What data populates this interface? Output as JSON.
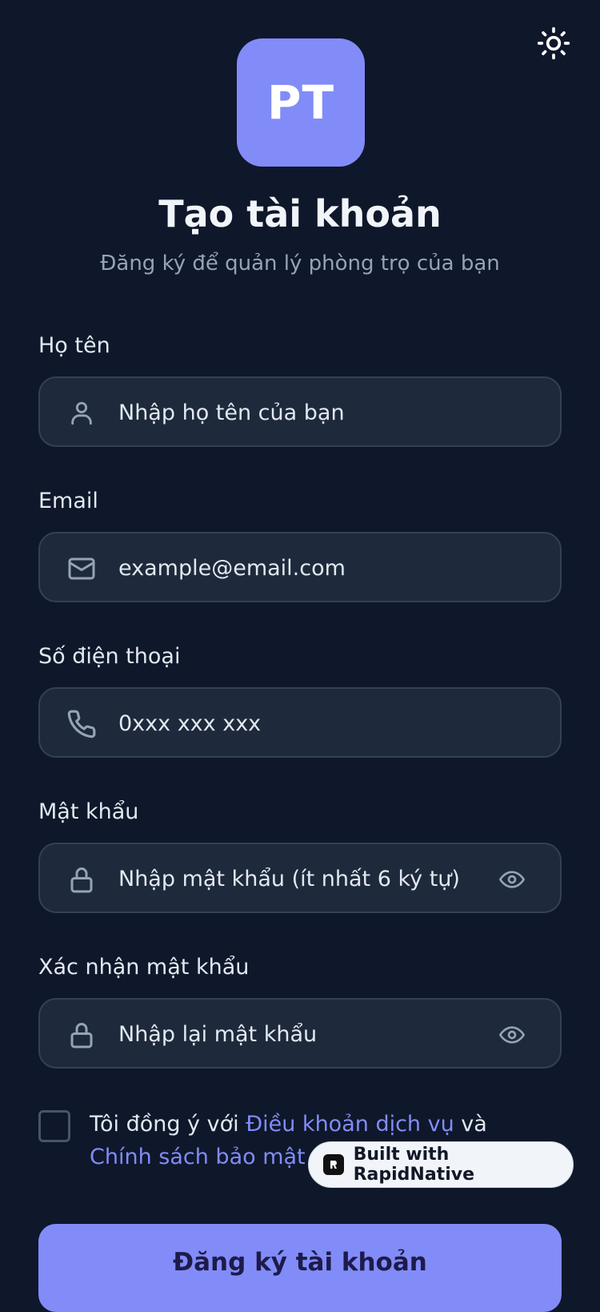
{
  "logo": {
    "text": "PT"
  },
  "header": {
    "title": "Tạo tài khoản",
    "subtitle": "Đăng ký để quản lý phòng trọ của bạn"
  },
  "form": {
    "fullname": {
      "label": "Họ tên",
      "placeholder": "Nhập họ tên của bạn",
      "icon": "user-icon"
    },
    "email": {
      "label": "Email",
      "placeholder": "example@email.com",
      "icon": "mail-icon"
    },
    "phone": {
      "label": "Số điện thoại",
      "placeholder": "0xxx xxx xxx",
      "icon": "phone-icon"
    },
    "password": {
      "label": "Mật khẩu",
      "placeholder": "Nhập mật khẩu (ít nhất 6 ký tự)",
      "icon": "lock-icon"
    },
    "confirm": {
      "label": "Xác nhận mật khẩu",
      "placeholder": "Nhập lại mật khẩu",
      "icon": "lock-icon"
    }
  },
  "terms": {
    "prefix": "Tôi đồng ý với ",
    "terms_link": "Điều khoản dịch vụ",
    "middle": " và ",
    "privacy_link": "Chính sách bảo mật"
  },
  "badge": {
    "text": "Built with RapidNative"
  },
  "submit": {
    "label": "Đăng ký tài khoản"
  },
  "colors": {
    "background": "#0f172a",
    "accent": "#818cf8",
    "field": "#1e293b",
    "border": "#334155"
  }
}
